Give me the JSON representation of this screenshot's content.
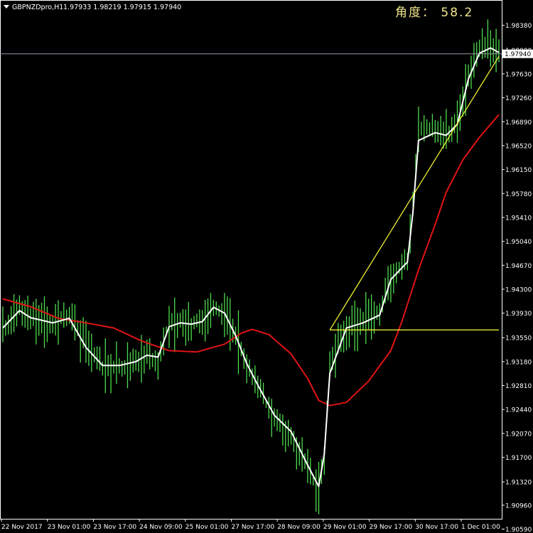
{
  "header": {
    "symbol_label": "GBPNZDpro,H1",
    "ohlc": "1.97933 1.98219 1.97915 1.97940",
    "angle_label": "角度： 58.2"
  },
  "colors": {
    "background": "#000000",
    "frame": "#ffffff",
    "candles": "#4ddb4d",
    "fast_ma": "#ffffff",
    "slow_ma": "#e01414",
    "trendline": "#ffff33",
    "bid_line": "#9a9aaa",
    "angle_text": "#f0e68c"
  },
  "chart_data": {
    "type": "line",
    "title": "GBPNZDpro,H1",
    "ylim": [
      1.9075,
      1.9875
    ],
    "current_price": "1.97940",
    "y_ticks": [
      "1.98380",
      "1.98000",
      "1.97630",
      "1.97260",
      "1.96890",
      "1.96520",
      "1.96150",
      "1.95780",
      "1.95410",
      "1.95040",
      "1.94670",
      "1.94300",
      "1.93930",
      "1.93550",
      "1.93180",
      "1.92810",
      "1.92440",
      "1.92070",
      "1.91700",
      "1.91320",
      "1.90960",
      "1.90590"
    ],
    "x_ticks": [
      "22 Nov 2017",
      "23 Nov 01:00",
      "23 Nov 17:00",
      "24 Nov 09:00",
      "25 Nov 01:00",
      "27 Nov 17:00",
      "28 Nov 09:00",
      "29 Nov 01:00",
      "29 Nov 17:00",
      "30 Nov 17:00",
      "1 Dec 01:00"
    ],
    "bar_count": 180,
    "series": [
      {
        "role": "price_midline",
        "values": [
          [
            0,
            1.9368
          ],
          [
            6,
            1.94
          ],
          [
            10,
            1.9385
          ],
          [
            18,
            1.9377
          ],
          [
            24,
            1.939
          ],
          [
            30,
            1.9348
          ],
          [
            36,
            1.9312
          ],
          [
            42,
            1.931
          ],
          [
            48,
            1.9318
          ],
          [
            52,
            1.933
          ],
          [
            56,
            1.9318
          ],
          [
            60,
            1.938
          ],
          [
            64,
            1.9378
          ],
          [
            68,
            1.9375
          ],
          [
            72,
            1.9382
          ],
          [
            76,
            1.9405
          ],
          [
            80,
            1.939
          ],
          [
            84,
            1.936
          ],
          [
            88,
            1.931
          ],
          [
            92,
            1.928
          ],
          [
            98,
            1.923
          ],
          [
            104,
            1.9205
          ],
          [
            110,
            1.9155
          ],
          [
            114,
            1.9118
          ],
          [
            116,
            1.917
          ],
          [
            118,
            1.932
          ],
          [
            124,
            1.9372
          ],
          [
            130,
            1.938
          ],
          [
            136,
            1.9392
          ],
          [
            140,
            1.945
          ],
          [
            146,
            1.9475
          ],
          [
            148,
            1.956
          ],
          [
            150,
            1.968
          ],
          [
            156,
            1.9675
          ],
          [
            160,
            1.9665
          ],
          [
            164,
            1.969
          ],
          [
            168,
            1.976
          ],
          [
            172,
            1.98
          ],
          [
            176,
            1.9805
          ],
          [
            179,
            1.9794
          ]
        ]
      },
      {
        "role": "fast_ma",
        "values": [
          [
            0,
            1.937
          ],
          [
            6,
            1.9397
          ],
          [
            10,
            1.9386
          ],
          [
            18,
            1.9378
          ],
          [
            24,
            1.9385
          ],
          [
            30,
            1.934
          ],
          [
            36,
            1.9312
          ],
          [
            42,
            1.9312
          ],
          [
            48,
            1.9318
          ],
          [
            52,
            1.9328
          ],
          [
            56,
            1.9325
          ],
          [
            60,
            1.9372
          ],
          [
            64,
            1.9378
          ],
          [
            68,
            1.9376
          ],
          [
            72,
            1.938
          ],
          [
            76,
            1.9402
          ],
          [
            80,
            1.9393
          ],
          [
            84,
            1.9358
          ],
          [
            88,
            1.9315
          ],
          [
            92,
            1.9282
          ],
          [
            98,
            1.9235
          ],
          [
            104,
            1.921
          ],
          [
            110,
            1.9158
          ],
          [
            114,
            1.9125
          ],
          [
            116,
            1.9175
          ],
          [
            118,
            1.93
          ],
          [
            124,
            1.937
          ],
          [
            130,
            1.9378
          ],
          [
            136,
            1.939
          ],
          [
            140,
            1.9445
          ],
          [
            146,
            1.9472
          ],
          [
            148,
            1.955
          ],
          [
            150,
            1.966
          ],
          [
            156,
            1.9672
          ],
          [
            160,
            1.9668
          ],
          [
            164,
            1.9685
          ],
          [
            168,
            1.9755
          ],
          [
            172,
            1.9795
          ],
          [
            176,
            1.9803
          ],
          [
            179,
            1.9796
          ]
        ]
      },
      {
        "role": "slow_ma",
        "values": [
          [
            0,
            1.9415
          ],
          [
            10,
            1.9403
          ],
          [
            20,
            1.9385
          ],
          [
            30,
            1.9378
          ],
          [
            40,
            1.937
          ],
          [
            50,
            1.935
          ],
          [
            60,
            1.9335
          ],
          [
            70,
            1.9333
          ],
          [
            80,
            1.9345
          ],
          [
            86,
            1.9362
          ],
          [
            90,
            1.9368
          ],
          [
            96,
            1.936
          ],
          [
            104,
            1.933
          ],
          [
            110,
            1.9292
          ],
          [
            114,
            1.9258
          ],
          [
            118,
            1.925
          ],
          [
            124,
            1.9255
          ],
          [
            132,
            1.9288
          ],
          [
            140,
            1.9335
          ],
          [
            144,
            1.938
          ],
          [
            150,
            1.946
          ],
          [
            156,
            1.953
          ],
          [
            160,
            1.958
          ],
          [
            166,
            1.963
          ],
          [
            172,
            1.9665
          ],
          [
            179,
            1.97
          ]
        ]
      }
    ],
    "trendlines": [
      {
        "role": "rising",
        "from": [
          118,
          1.9367
        ],
        "to": [
          179,
          1.979
        ]
      },
      {
        "role": "horizontal",
        "from": [
          118,
          1.9367
        ],
        "to": [
          179,
          1.9367
        ]
      }
    ]
  }
}
